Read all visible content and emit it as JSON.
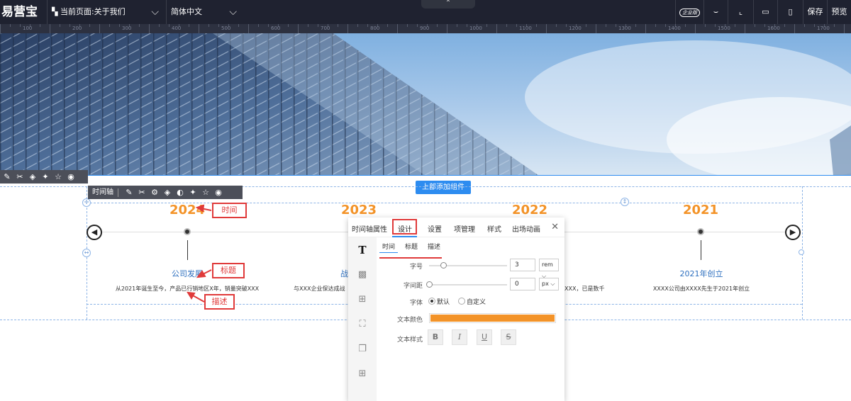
{
  "topbar": {
    "logo": "易营宝",
    "page_select": "当前页面:关于我们",
    "lang_select": "简体中文",
    "badge": "企业版",
    "save": "保存",
    "preview": "预览",
    "icons": [
      "enterprise-badge-icon",
      "eye-closed-icon",
      "crop-icon",
      "desktop-icon",
      "mobile-icon"
    ]
  },
  "ruler": {
    "labels": [
      "100",
      "200",
      "300",
      "400",
      "500",
      "600",
      "700",
      "800",
      "900",
      "1000",
      "1100",
      "1200",
      "1300",
      "1400",
      "1500",
      "1600",
      "1700"
    ]
  },
  "section": {
    "add_top_label": "上部添加组件",
    "toolbar_icons": [
      "edit-icon",
      "tools-icon",
      "layers-icon",
      "magic-icon",
      "star-icon",
      "eye-icon"
    ]
  },
  "component_toolbar": {
    "name": "时间轴",
    "icons": [
      "edit-icon",
      "tools-icon",
      "settings-icon",
      "layers-icon",
      "palette-icon",
      "magic-icon",
      "star-icon",
      "eye-icon"
    ]
  },
  "timeline": {
    "prev_arrow": "◀",
    "next_arrow": "▶",
    "items": [
      {
        "year": "2024",
        "title": "公司发展",
        "desc": "从2021年诞生至今，产品已行销地区X年，销量突破XXX"
      },
      {
        "year": "2023",
        "title": "战",
        "desc": "与XXX企业保达成战"
      },
      {
        "year": "2022",
        "title": "",
        "desc": "XXX，已是数千"
      },
      {
        "year": "2021",
        "title": "2021年创立",
        "desc": "XXXX公司由XXXX先生于2021年创立"
      }
    ]
  },
  "annotations": {
    "time": "时间",
    "title": "标题",
    "desc": "描述",
    "color": "#e03a3a"
  },
  "panel": {
    "tabs": [
      "时间轴属性",
      "设计",
      "设置",
      "项管理",
      "样式",
      "出场动画"
    ],
    "active_tab": "设计",
    "close": "✕",
    "subtabs": [
      "时间",
      "标题",
      "描述"
    ],
    "active_subtab": "时间",
    "side_icons": [
      "text-icon",
      "texture-icon",
      "border-icon",
      "corner-icon",
      "shadow-icon",
      "spacing-icon"
    ],
    "font_size": {
      "label": "字号",
      "value": "3",
      "unit": "rem",
      "slider": 0.18
    },
    "letter_spacing": {
      "label": "字间距",
      "value": "0",
      "unit": "px",
      "slider": 0.0
    },
    "font_family": {
      "label": "字体",
      "options": [
        "默认",
        "自定义"
      ],
      "selected": "默认"
    },
    "text_color": {
      "label": "文本颜色",
      "value": "#f39328"
    },
    "text_style": {
      "label": "文本样式",
      "buttons": [
        "B",
        "I",
        "U",
        "S"
      ]
    }
  },
  "colors": {
    "year": "#f39328",
    "title": "#2d6fbf",
    "accent": "#2d8cf0",
    "topbar": "#1f2230"
  }
}
